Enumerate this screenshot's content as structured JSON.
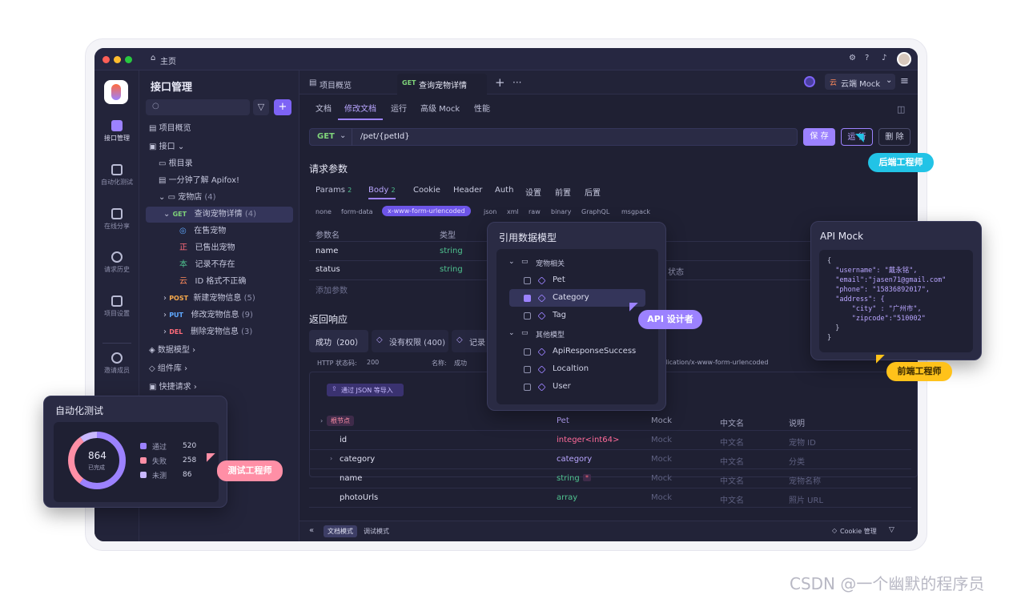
{
  "titlebar": {
    "home": "主页"
  },
  "rail": {
    "items": [
      "接口管理",
      "自动化测试",
      "在线分享",
      "请求历史",
      "项目设置",
      "邀请成员"
    ]
  },
  "tree": {
    "title": "接口管理",
    "items": [
      {
        "label": "项目概览"
      },
      {
        "label": "接口"
      },
      {
        "label": "根目录"
      },
      {
        "label": "一分钟了解 Apifox!"
      },
      {
        "label": "宠物店",
        "count": "(4)"
      },
      {
        "method": "GET",
        "label": "查询宠物详情",
        "count": "(4)"
      },
      {
        "label": "在售宠物"
      },
      {
        "label": "已售出宠物"
      },
      {
        "label": "记录不存在"
      },
      {
        "label": "ID 格式不正确"
      },
      {
        "method": "POST",
        "label": "新建宠物信息",
        "count": "(5)"
      },
      {
        "method": "PUT",
        "label": "修改宠物信息",
        "count": "(9)"
      },
      {
        "method": "DEL",
        "label": "删除宠物信息",
        "count": "(3)"
      },
      {
        "label": "数据模型"
      },
      {
        "label": "组件库"
      },
      {
        "label": "快捷请求"
      }
    ],
    "badge_icons": [
      "globe-icon",
      "zheng-icon",
      "ben-icon",
      "yun-icon"
    ],
    "badge_glyphs": [
      "◎",
      "正",
      "本",
      "云"
    ]
  },
  "topbar": {
    "tab1": "项目概览",
    "tab2_method": "GET",
    "tab2_label": "查询宠物详情",
    "add": "+",
    "more": "···",
    "mock": "云端 Mock"
  },
  "subtabs": [
    "文档",
    "修改文档",
    "运行",
    "高级 Mock",
    "性能"
  ],
  "request": {
    "method": "GET",
    "path": "/pet/{petId}",
    "save": "保 存",
    "run": "运 行",
    "delete": "删 除"
  },
  "params": {
    "heading": "请求参数",
    "tabs": [
      "Params",
      "Body",
      "Cookie",
      "Header",
      "Auth",
      "设置",
      "前置",
      "后置"
    ],
    "params_count": "2",
    "body_count": "2",
    "body_types": [
      "none",
      "form-data",
      "x-www-form-urlencoded",
      "json",
      "xml",
      "raw",
      "binary",
      "GraphQL",
      "msgpack"
    ],
    "col_name": "参数名",
    "col_type": "类型",
    "rows": [
      {
        "name": "name",
        "type": "string"
      },
      {
        "name": "status",
        "type": "string",
        "desc": "状态"
      }
    ],
    "add": "添加参数"
  },
  "response": {
    "heading": "返回响应",
    "tabs": [
      "成功（200）",
      "没有权限 (400)",
      "记录"
    ],
    "status_label": "HTTP 状态码:",
    "status_value": "200",
    "name_label": "名称:",
    "name_value": "成功",
    "content_type": "plication/x-www-form-urlencoded",
    "import": "通过 JSON 等导入",
    "schema_headers": [
      "根节点",
      "Pet",
      "Mock",
      "中文名",
      "说明"
    ],
    "schema_rows": [
      {
        "name": "id",
        "type": "integer<int64>",
        "mock": "Mock",
        "cn": "中文名",
        "desc": "宠物 ID"
      },
      {
        "name": "category",
        "type": "category",
        "mock": "Mock",
        "cn": "中文名",
        "desc": "分类"
      },
      {
        "name": "name",
        "type": "string",
        "mock": "Mock",
        "cn": "中文名",
        "desc": "宠物名称",
        "required": "*"
      },
      {
        "name": "photoUrls",
        "type": "array",
        "mock": "Mock",
        "cn": "中文名",
        "desc": "照片 URL"
      }
    ]
  },
  "footer": {
    "collapse": "«",
    "doc_mode": "文档模式",
    "debug_mode": "调试模式",
    "cookie": "Cookie 管理"
  },
  "model_popup": {
    "title": "引用数据模型",
    "groups": [
      {
        "name": "宠物相关",
        "items": [
          {
            "label": "Pet",
            "checked": false
          },
          {
            "label": "Category",
            "checked": true
          },
          {
            "label": "Tag",
            "checked": false
          }
        ]
      },
      {
        "name": "其他模型",
        "items": [
          {
            "label": "ApiResponseSuccess",
            "checked": false
          },
          {
            "label": "Localtion",
            "checked": false
          },
          {
            "label": "User",
            "checked": false
          }
        ]
      }
    ]
  },
  "mock_card": {
    "title": "API Mock",
    "lines": [
      "{",
      "  \"username\": \"戴永铭\",",
      "  \"email\":\"jasen71@gmail.com\"",
      "  \"phone\": \"15836892017\",",
      "  \"address\": {",
      "      \"city\" : \"广州市\",",
      "      \"zipcode\":\"510002\"",
      "  }",
      "}"
    ]
  },
  "auto_card": {
    "title": "自动化测试",
    "total": "864",
    "total_label": "已完成",
    "stats": [
      {
        "label": "通过",
        "value": 520,
        "color": "#9c82ff"
      },
      {
        "label": "失败",
        "value": 258,
        "color": "#ff8fa6"
      },
      {
        "label": "未测",
        "value": 86,
        "color": "#c9b8ff"
      }
    ]
  },
  "roles": {
    "backend": "后端工程师",
    "api": "API 设计者",
    "frontend": "前端工程师",
    "tester": "测试工程师"
  },
  "colors": {
    "accent": "#9c82ff",
    "backend": "#22c3e6",
    "api": "#9c82ff",
    "frontend": "#ffc21a",
    "tester": "#ff8fa6"
  },
  "watermark": "CSDN @一个幽默的程序员"
}
